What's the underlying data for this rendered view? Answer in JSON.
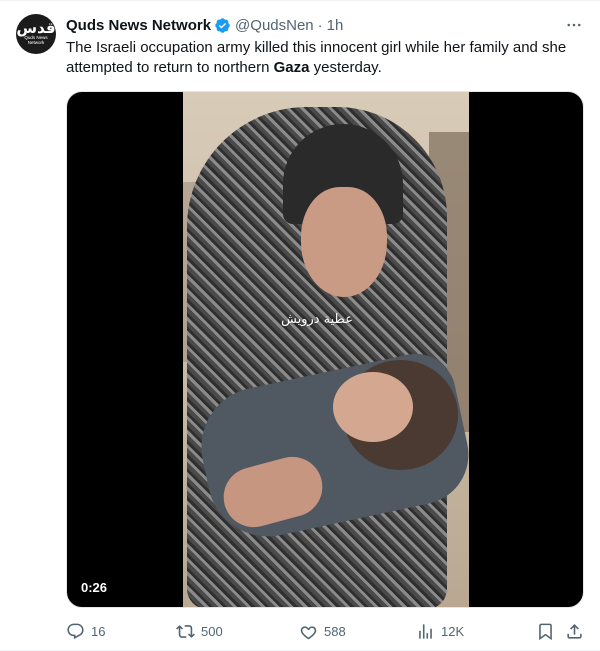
{
  "tweet": {
    "avatar": {
      "logo_main": "قدس",
      "logo_sub": "Quds News Network"
    },
    "display_name": "Quds News Network",
    "handle": "@QudsNen",
    "separator": "·",
    "time": "1h",
    "text_before": "The Israeli occupation army killed this innocent girl while her family and she attempted to return to northern ",
    "text_bold": "Gaza",
    "text_after": " yesterday.",
    "media": {
      "watermark": "عطية درويش",
      "duration": "0:26"
    },
    "actions": {
      "reply_count": "16",
      "retweet_count": "500",
      "like_count": "588",
      "view_count": "12K"
    }
  },
  "colors": {
    "text": "#0f1419",
    "secondary": "#536471",
    "verified": "#1d9bf0"
  },
  "icons": [
    "verified-badge-icon",
    "more-icon",
    "reply-icon",
    "retweet-icon",
    "like-icon",
    "views-icon",
    "bookmark-icon",
    "share-icon"
  ]
}
